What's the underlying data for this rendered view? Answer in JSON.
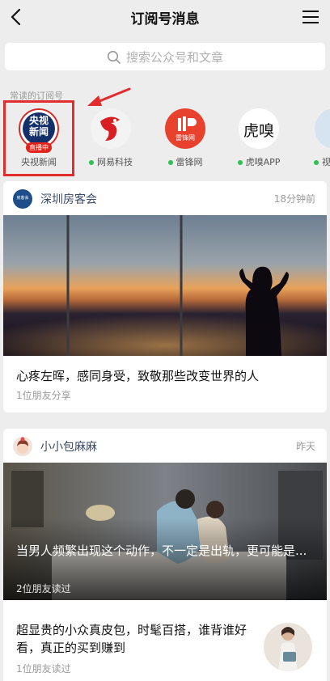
{
  "nav": {
    "title": "订阅号消息",
    "back_icon": "chevron-left-icon",
    "menu_icon": "hamburger-menu-icon"
  },
  "search": {
    "placeholder": "搜索公众号和文章",
    "icon": "search-icon"
  },
  "frequent": {
    "label": "常读的订阅号",
    "items": [
      {
        "name": "央视新闻",
        "logo_text_top": "央视",
        "logo_text_bottom": "新闻",
        "badge": "直播中",
        "highlighted": true
      },
      {
        "name": "网易科技",
        "has_dot": true
      },
      {
        "name": "雷锋网",
        "logo_text": "雷锋网",
        "has_dot": true
      },
      {
        "name": "虎嗅APP",
        "logo_text": "虎嗅",
        "has_dot": true
      },
      {
        "name": "视觉",
        "has_dot": true
      }
    ]
  },
  "cards": [
    {
      "source": "深圳房客会",
      "avatar_text": "房客会",
      "time": "18分钟前",
      "title": "心疼左晖，感同身受，致敬那些改变世界的人",
      "sub": "1位朋友分享"
    },
    {
      "source": "小小包麻麻",
      "time": "昨天",
      "overlay_title": "当男人频繁出现这个动作，不一定是出轨，更可能是...",
      "overlay_sub": "2位朋友读过",
      "article2_title": "超显贵的小众真皮包，时髦百搭，谁背谁好看，真正的买到赚到",
      "article2_sub": "1位朋友读过"
    }
  ],
  "colors": {
    "background": "#ededed",
    "highlight": "#e12d2d",
    "accent_green": "#2fbf55",
    "live_red": "#e2231a"
  }
}
